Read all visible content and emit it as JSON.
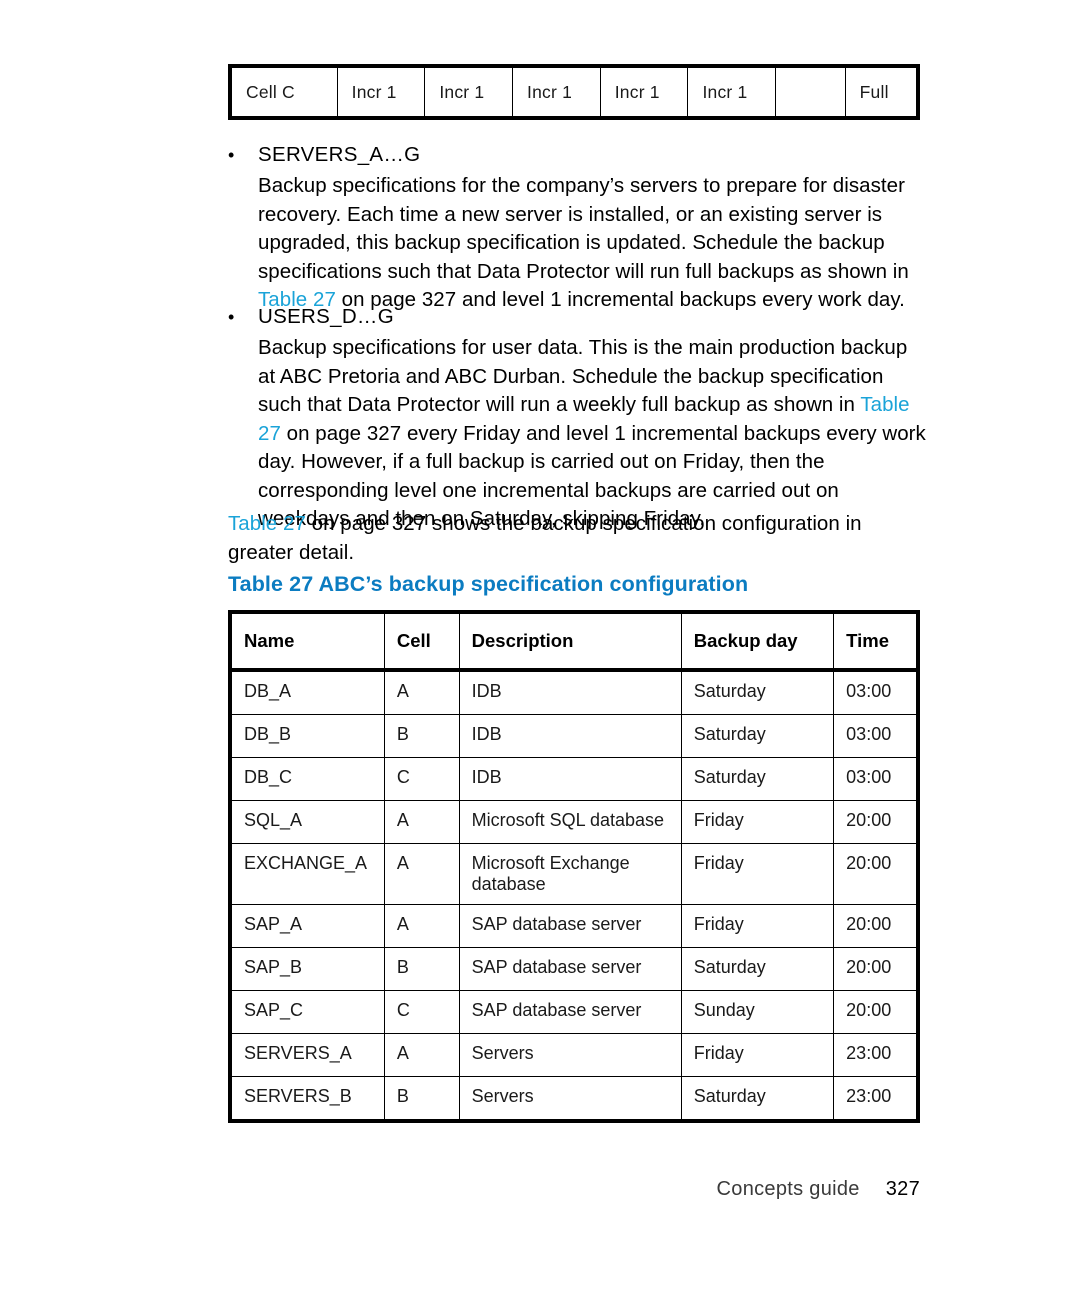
{
  "top_table": {
    "cells": [
      "Cell C",
      "Incr 1",
      "Incr 1",
      "Incr 1",
      "Incr 1",
      "Incr 1",
      "",
      "Full"
    ]
  },
  "bullets": [
    {
      "marker": "•",
      "title": "SERVERS_A…G",
      "paragraph_parts": [
        {
          "text": "Backup specifications for the company’s servers to prepare for disaster recovery. Each time a new server is installed, or an existing server is upgraded, this backup specification is updated. Schedule the backup specifications such that Data Protector will run full backups as shown in "
        },
        {
          "text": "Table 27",
          "link": true
        },
        {
          "text": " on page 327 and level 1 incremental backups every work day."
        }
      ]
    },
    {
      "marker": "•",
      "title": "USERS_D…G",
      "paragraph_parts": [
        {
          "text": "Backup specifications for user data. This is the main production backup at ABC Pretoria and ABC Durban. Schedule the backup specification such that Data Protector will run a weekly full backup as shown in "
        },
        {
          "text": "Table 27",
          "link": true
        },
        {
          "text": " on page 327 every Friday and level 1 incremental backups every work day. However, if a full backup is carried out on Friday, then the corresponding level one incremental backups are carried out on weekdays and then on Saturday, skipping Friday."
        }
      ]
    }
  ],
  "closing_paragraph_parts": [
    {
      "text": "Table 27",
      "link": true
    },
    {
      "text": " on page 327 shows the backup specification configuration in greater detail."
    }
  ],
  "table_caption": "Table 27 ABC’s backup specification configuration",
  "main_table": {
    "headers": [
      "Name",
      "Cell",
      "Description",
      "Backup day",
      "Time"
    ],
    "rows": [
      [
        "DB_A",
        "A",
        "IDB",
        "Saturday",
        "03:00"
      ],
      [
        "DB_B",
        "B",
        "IDB",
        "Saturday",
        "03:00"
      ],
      [
        "DB_C",
        "C",
        "IDB",
        "Saturday",
        "03:00"
      ],
      [
        "SQL_A",
        "A",
        "Microsoft SQL database",
        "Friday",
        "20:00"
      ],
      [
        "EXCHANGE_A",
        "A",
        "Microsoft Exchange database",
        "Friday",
        "20:00"
      ],
      [
        "SAP_A",
        "A",
        "SAP database server",
        "Friday",
        "20:00"
      ],
      [
        "SAP_B",
        "B",
        "SAP database server",
        "Saturday",
        "20:00"
      ],
      [
        "SAP_C",
        "C",
        "SAP database server",
        "Sunday",
        "20:00"
      ],
      [
        "SERVERS_A",
        "A",
        "Servers",
        "Friday",
        "23:00"
      ],
      [
        "SERVERS_B",
        "B",
        "Servers",
        "Saturday",
        "23:00"
      ]
    ]
  },
  "footer": {
    "label": "Concepts guide",
    "page": "327"
  },
  "colors": {
    "link": "#1aa3d8",
    "caption": "#0b7cc1",
    "rule": "#000000"
  }
}
